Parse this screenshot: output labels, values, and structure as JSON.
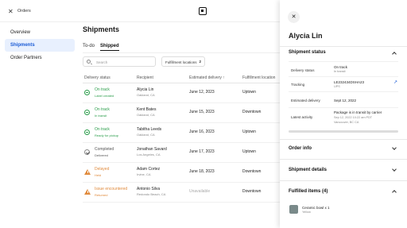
{
  "topbar": {
    "close_glyph": "✕",
    "title": "Orders"
  },
  "sidebar": {
    "items": [
      {
        "label": "Overview",
        "active": false
      },
      {
        "label": "Shipments",
        "active": true
      },
      {
        "label": "Order Partners",
        "active": false
      }
    ]
  },
  "main": {
    "title": "Shipments",
    "tabs": [
      {
        "label": "To-do",
        "active": false
      },
      {
        "label": "Shipped",
        "active": true
      }
    ],
    "search_placeholder": "Search",
    "filter": {
      "label": "Fulfillment locations",
      "count": "2"
    },
    "columns": {
      "status": "Delivery status",
      "recipient": "Recipient",
      "est": "Estimated delivery",
      "est_sort_glyph": "↑",
      "location": "Fulfillment location"
    },
    "rows": [
      {
        "icon": "arrow-circle-icon",
        "status": "On track",
        "sub": "Label created",
        "name": "Alycia Lin",
        "city": "Oakland, CA",
        "date": "June 12, 2023",
        "loc": "Uptown"
      },
      {
        "icon": "arrow-circle-icon",
        "status": "On track",
        "sub": "In transit",
        "name": "Kent Bates",
        "city": "Oakland, CA",
        "date": "June 15, 2023",
        "loc": "Downtown"
      },
      {
        "icon": "arrow-circle-icon",
        "status": "On track",
        "sub": "Ready for pickup",
        "name": "Tabitha Leeds",
        "city": "Oakland, CA",
        "date": "June 16, 2023",
        "loc": "Uptown"
      },
      {
        "icon": "check-circle-icon",
        "status": "Completed",
        "sub": "Delivered",
        "name": "Jonathan Savard",
        "city": "Los Angeles, CA",
        "date": "June 17, 2023",
        "loc": "Uptown"
      },
      {
        "icon": "warning-icon",
        "status": "Delayed",
        "sub": "Held",
        "name": "Adam Cortez",
        "city": "Irvine, CA",
        "date": "June 18, 2023",
        "loc": "Downtown"
      },
      {
        "icon": "warning-icon",
        "status": "Issue encountered",
        "sub": "Returned",
        "name": "Antonio Silva",
        "city": "Redondo Beach, CA",
        "date": "Unavailable",
        "loc": "Downtown"
      }
    ]
  },
  "panel": {
    "close_glyph": "✕",
    "name": "Alycia Lin",
    "shipment_status": {
      "title": "Shipment status",
      "delivery_key": "Delivery status",
      "delivery_val": "On track",
      "delivery_sub": "In transit",
      "tracking_key": "Tracking",
      "tracking_val": "LE232434DSHA23",
      "tracking_sub": "UPS",
      "tracking_glyph": "↗",
      "est_key": "Estimated delivery",
      "est_val": "Sept 12, 2022",
      "activity_key": "Latest activity",
      "activity_val": "Package is in transit by carrier",
      "activity_sub1": "Sep 12, 2022 10:22 am PDT",
      "activity_sub2": "Vancouver, BC CA"
    },
    "order_info": "Order info",
    "shipment_details": "Shipment details",
    "fulfilled_items": "Fulfilled items (4)",
    "item": {
      "name": "Ceramic bowl x 1",
      "sub": "Yellow"
    }
  },
  "colors": {
    "accent": "#1a5bd6",
    "success": "#2a9d4a",
    "warning": "#e08a3c"
  }
}
